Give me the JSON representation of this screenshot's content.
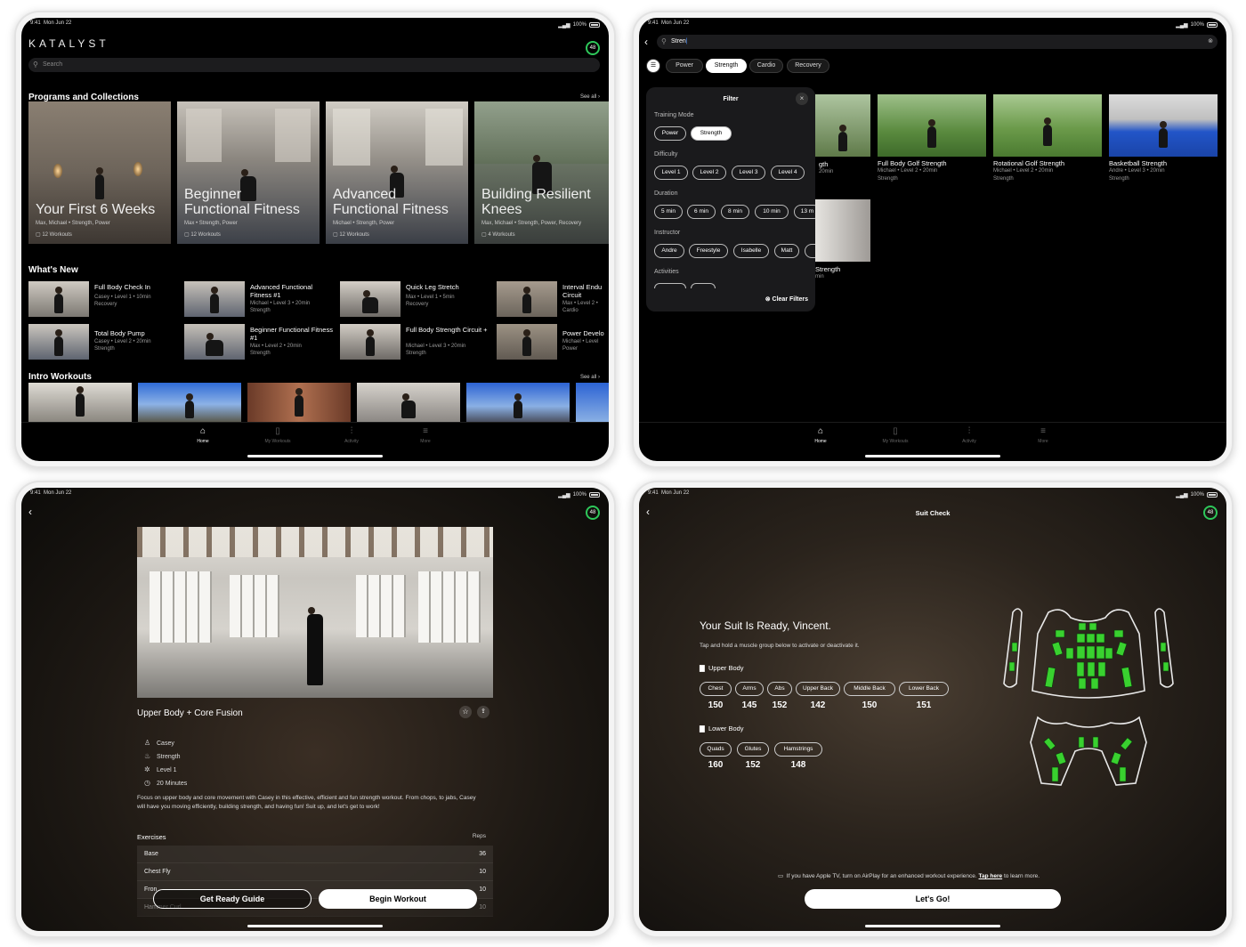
{
  "status": {
    "time": "9:41",
    "date": "Mon Jun 22",
    "battery": "100%"
  },
  "ring_value": "48",
  "home": {
    "logo": "KATALYST",
    "search_placeholder": "Search",
    "programs_title": "Programs and Collections",
    "see_all": "See all",
    "programs": [
      {
        "title_1": "Your First 6 Weeks",
        "title_2": "",
        "meta": "Max, Michael • Strength, Power",
        "workouts": "12 Workouts"
      },
      {
        "title_1": "Beginner",
        "title_2": "Functional Fitness",
        "meta": "Max • Strength, Power",
        "workouts": "12 Workouts"
      },
      {
        "title_1": "Advanced",
        "title_2": "Functional Fitness",
        "meta": "Michael • Strength, Power",
        "workouts": "12 Workouts"
      },
      {
        "title_1": "Building Resilient",
        "title_2": "Knees",
        "meta": "Max, Michael • Strength, Power, Recovery",
        "workouts": "4 Workouts"
      }
    ],
    "whats_new_title": "What's New",
    "whats_new": [
      {
        "title": "Full Body Check In",
        "line1": "Casey • Level 1 • 10min",
        "line2": "Recovery"
      },
      {
        "title": "Advanced Functional Fitness #1",
        "line1": "Michael • Level 3 • 20min",
        "line2": "Strength"
      },
      {
        "title": "Quick Leg Stretch",
        "line1": "Max • Level 1 • 5min",
        "line2": "Recovery"
      },
      {
        "title": "Interval Endu Circuit",
        "line1": "Max • Level 2 •",
        "line2": "Cardio"
      },
      {
        "title": "Total Body Pump",
        "line1": "Casey • Level 2 • 20min",
        "line2": "Strength"
      },
      {
        "title": "Beginner Functional Fitness #1",
        "line1": "Max • Level 2 • 20min",
        "line2": "Strength"
      },
      {
        "title": "Full Body Strength Circuit +",
        "line1": "Michael • Level 3 • 20min",
        "line2": "Strength"
      },
      {
        "title": "Power Develo",
        "line1": "Michael • Level",
        "line2": "Power"
      }
    ],
    "intro_title": "Intro Workouts"
  },
  "tabs": [
    "Home",
    "My Workouts",
    "Activity",
    "More"
  ],
  "search": {
    "query": "Stren",
    "chips": [
      "Power",
      "Strength",
      "Cardio",
      "Recovery"
    ],
    "filter": {
      "title": "Filter",
      "training_mode_label": "Training Mode",
      "training_modes": [
        "Power",
        "Strength"
      ],
      "difficulty_label": "Difficulty",
      "difficulties": [
        "Level 1",
        "Level 2",
        "Level 3",
        "Level 4"
      ],
      "duration_label": "Duration",
      "durations": [
        "5 min",
        "6 min",
        "8 min",
        "10 min",
        "13 m"
      ],
      "instructor_label": "Instructor",
      "instructors": [
        "Andre",
        "Freestyle",
        "Isabelle",
        "Matt"
      ],
      "activities_label": "Activities",
      "clear": "Clear Filters"
    },
    "results": [
      {
        "title": "Full Body Golf Strength",
        "line1": "Michael • Level 2 • 20min",
        "line2": "Strength"
      },
      {
        "title": "Rotational Golf Strength",
        "line1": "Michael • Level 2 • 20min",
        "line2": "Strength"
      },
      {
        "title": "Basketball Strength",
        "line1": "Andre • Level 3 • 20min",
        "line2": "Strength"
      }
    ],
    "partial_1": {
      "title": "gth",
      "line1": "20min"
    },
    "partial_2": {
      "title": "Strength",
      "line1": "min"
    }
  },
  "detail": {
    "title": "Upper Body + Core Fusion",
    "instructor": "Casey",
    "mode": "Strength",
    "level": "Level 1",
    "duration": "20 Minutes",
    "description": "Focus on upper body and core movement with Casey in this effective, efficient and fun strength workout. From chops, to jabs, Casey will have you moving efficiently, building strength, and having fun! Suit up, and let's get to work!",
    "exercises_label": "Exercises",
    "reps_label": "Reps",
    "exercises": [
      {
        "name": "Base",
        "reps": "36"
      },
      {
        "name": "Chest Fly",
        "reps": "10"
      },
      {
        "name": "Fron",
        "reps": "10"
      },
      {
        "name": "Hammer Curl",
        "reps": "10"
      }
    ],
    "get_ready": "Get Ready Guide",
    "begin": "Begin Workout"
  },
  "suit": {
    "title": "Suit Check",
    "heading": "Your Suit Is Ready, Vincent.",
    "instruction": "Tap and hold a muscle group below to activate or deactivate it.",
    "upper_label": "Upper Body",
    "upper": [
      {
        "name": "Chest",
        "value": "150"
      },
      {
        "name": "Arms",
        "value": "145"
      },
      {
        "name": "Abs",
        "value": "152"
      },
      {
        "name": "Upper Back",
        "value": "142"
      },
      {
        "name": "Middle Back",
        "value": "150"
      },
      {
        "name": "Lower Back",
        "value": "151"
      }
    ],
    "lower_label": "Lower Body",
    "lower": [
      {
        "name": "Quads",
        "value": "160"
      },
      {
        "name": "Glutes",
        "value": "152"
      },
      {
        "name": "Hamstrings",
        "value": "148"
      }
    ],
    "airplay_text": "If you have Apple TV, turn on AirPlay for an enhanced workout experience.",
    "airplay_link": "Tap here",
    "airplay_tail": "to learn more.",
    "go": "Let's Go!",
    "pad_color": "#39d12f"
  }
}
